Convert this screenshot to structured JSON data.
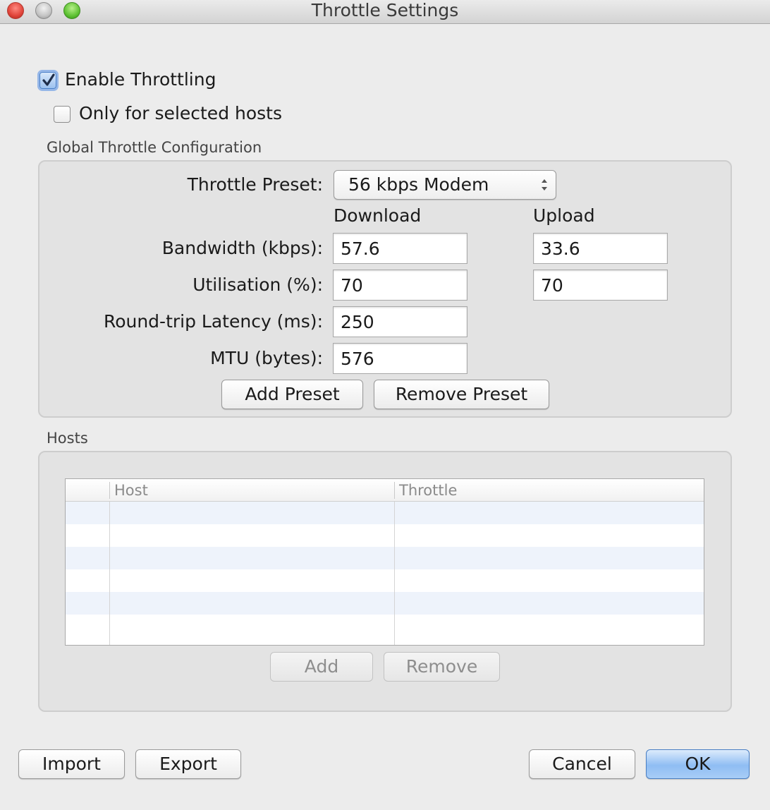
{
  "window": {
    "title": "Throttle Settings"
  },
  "options": {
    "enable_throttling": {
      "label": "Enable Throttling",
      "checked": true
    },
    "only_selected_hosts": {
      "label": "Only for selected hosts",
      "checked": false
    }
  },
  "global_config": {
    "title": "Global Throttle Configuration",
    "preset_label": "Throttle Preset:",
    "preset_value": "56 kbps Modem",
    "download_header": "Download",
    "upload_header": "Upload",
    "bandwidth_label": "Bandwidth (kbps):",
    "bandwidth_download": "57.6",
    "bandwidth_upload": "33.6",
    "utilisation_label": "Utilisation (%):",
    "utilisation_download": "70",
    "utilisation_upload": "70",
    "latency_label": "Round-trip Latency (ms):",
    "latency_value": "250",
    "mtu_label": "MTU (bytes):",
    "mtu_value": "576",
    "add_preset_label": "Add Preset",
    "remove_preset_label": "Remove Preset"
  },
  "hosts": {
    "title": "Hosts",
    "columns": [
      "",
      "Host",
      "Throttle"
    ],
    "rows": [],
    "add_label": "Add",
    "remove_label": "Remove"
  },
  "footer": {
    "import_label": "Import",
    "export_label": "Export",
    "cancel_label": "Cancel",
    "ok_label": "OK"
  },
  "colors": {
    "accent": "#4a80c8",
    "close": "#e0443a",
    "minimize": "#c4c4c4",
    "zoom": "#5fc234"
  }
}
